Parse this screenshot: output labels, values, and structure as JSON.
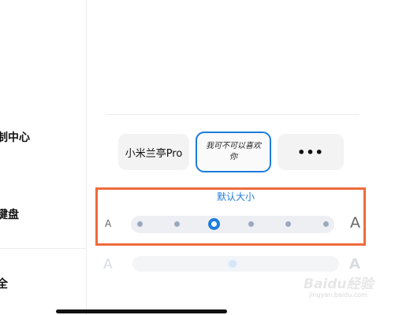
{
  "sidebar": {
    "items": [
      {
        "label": "制中心"
      },
      {
        "label": "键盘"
      },
      {
        "label": "全"
      }
    ]
  },
  "fonts": {
    "items": [
      {
        "label": "小米兰亭Pro"
      },
      {
        "label": "我可不可以喜欢你"
      },
      {
        "label": "•••"
      }
    ],
    "selected_index": 1
  },
  "size": {
    "label": "默认大小",
    "small_glyph": "A",
    "large_glyph": "A",
    "steps": 6,
    "selected_step": 3
  },
  "secondary_size": {
    "small_glyph": "A",
    "large_glyph": "A",
    "level_fraction": 0.5
  },
  "watermark": {
    "text": "Baidu经验",
    "sub": "jingyan.baidu.com"
  },
  "colors": {
    "accent": "#1e7ddc",
    "highlight_box": "#ee6b3a",
    "tick": "#9aa8bf"
  }
}
